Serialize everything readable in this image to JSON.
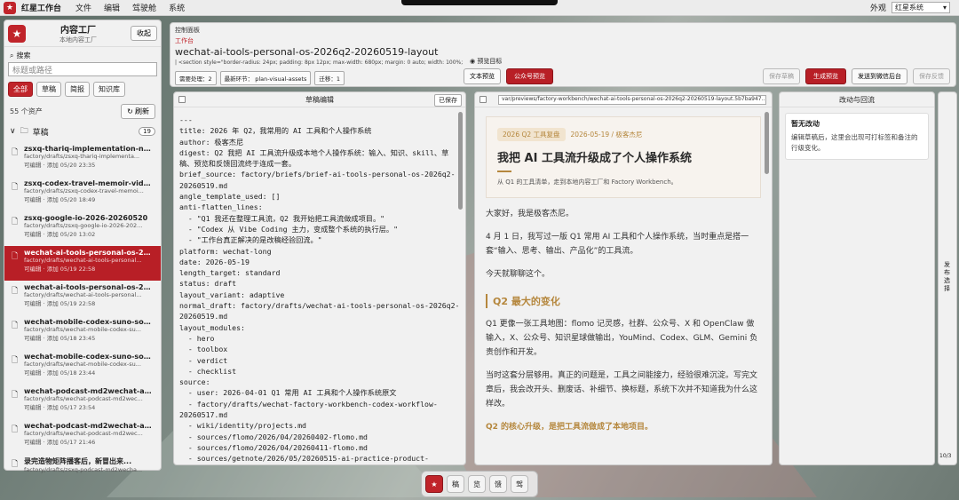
{
  "menubar": {
    "app_title": "红星工作台",
    "items": [
      "文件",
      "编辑",
      "驾驶舱",
      "系统"
    ],
    "appearance_label": "外观",
    "appearance_value": "红星系统"
  },
  "sidebar": {
    "title": "内容工厂",
    "subtitle": "本地内容工厂",
    "collapse_label": "收起",
    "search_label": "搜索",
    "search_placeholder": "标题或路径",
    "chips": [
      "全部",
      "草稿",
      "简报",
      "知识库"
    ],
    "asset_count": "55 个资产",
    "refresh_label": "刷新",
    "folder_name": "草稿",
    "folder_count": "19",
    "items": [
      {
        "name": "zsxq-thariq-implementation-note...",
        "path": "factory/drafts/zsxq-thariq-implementa...",
        "meta": "可编辑 · 添加 05/20 23:35"
      },
      {
        "name": "zsxq-codex-travel-memoir-video-...",
        "path": "factory/drafts/zsxq-codex-travel-memoi...",
        "meta": "可编辑 · 添加 05/20 18:49"
      },
      {
        "name": "zsxq-google-io-2026-20260520",
        "path": "factory/drafts/zsxq-google-io-2026-202...",
        "meta": "可编辑 · 添加 05/20 13:02"
      },
      {
        "name": "wechat-ai-tools-personal-os-202...",
        "path": "factory/drafts/wechat-ai-tools-personal...",
        "meta": "可编辑 · 添加 05/19 22:58"
      },
      {
        "name": "wechat-ai-tools-personal-os-202...",
        "path": "factory/drafts/wechat-ai-tools-personal...",
        "meta": "可编辑 · 添加 05/19 22:58"
      },
      {
        "name": "wechat-mobile-codex-suno-song...",
        "path": "factory/drafts/wechat-mobile-codex-su...",
        "meta": "可编辑 · 添加 05/18 23:45"
      },
      {
        "name": "wechat-mobile-codex-suno-song...",
        "path": "factory/drafts/wechat-mobile-codex-su...",
        "meta": "可编辑 · 添加 05/18 23:44"
      },
      {
        "name": "wechat-podcast-md2wechat-age...",
        "path": "factory/drafts/wechat-podcast-md2wec...",
        "meta": "可编辑 · 添加 05/17 23:54"
      },
      {
        "name": "wechat-podcast-md2wechat-age...",
        "path": "factory/drafts/wechat-podcast-md2wec...",
        "meta": "可编辑 · 添加 05/17 21:46"
      },
      {
        "name": "录完造物矩阵播客后，新冒出来...",
        "path": "factory/drafts/zsxq-podcast-md2wecha...",
        "meta": ""
      }
    ]
  },
  "control": {
    "panel_label": "控制面板",
    "workspace_label": "工作台",
    "title": "wechat-ai-tools-personal-os-2026q2-20260519-layout",
    "style_code": "| <section style=\"border-radius: 24px; padding: 8px 12px; max-width: 680px; margin: 0 auto; width: 100%; box-sizing: b",
    "target_label": "预览目标",
    "tags": [
      "需要处理：2",
      "最新环节： plan-visual-assets",
      "迁移：1"
    ],
    "text_preview_label": "文本预览",
    "wechat_preview_label": "公众号预览",
    "save_draft_label": "保存草稿",
    "generate_preview_label": "生成预览",
    "send_backend_label": "发送到微信后台",
    "save_feedback_label": "保存反馈"
  },
  "editor": {
    "header": "草稿编辑",
    "save_label": "已保存",
    "content": "---\ntitle: 2026 年 Q2，我常用的 AI 工具和个人操作系统\nauthor: 极客杰尼\ndigest: Q2 我把 AI 工具流升级成本地个人操作系统：输入、知识、skill、草稿、预览和反馈回流终于连成一套。\nbrief_source: factory/briefs/brief-ai-tools-personal-os-2026q2-20260519.md\nangle_template_used: []\nanti-flatten_lines:\n  - \"Q1 我还在整理工具流，Q2 我开始把工具流做成项目。\"\n  - \"Codex 从 Vibe Coding 主力，变成整个系统的执行层。\"\n  - \"工作台真正解决的是改稿经验回流。\"\nplatform: wechat-long\ndate: 2026-05-19\nlength_target: standard\nstatus: draft\nlayout_variant: adaptive\nnormal_draft: factory/drafts/wechat-ai-tools-personal-os-2026q2-20260519.md\nlayout_modules:\n  - hero\n  - toolbox\n  - verdict\n  - checklist\nsource:\n  - user: 2026-04-01 Q1 常用 AI 工具和个人操作系统原文\n  - factory/drafts/wechat-factory-workbench-codex-workflow-20260517.md\n  - wiki/identity/projects.md\n  - sources/flomo/2026/04/20260402-flomo.md\n  - sources/flomo/2026/04/20260411-flomo.md\n  - sources/getnote/2026/05/20260515-ai-practice-product-"
  },
  "preview": {
    "path": "var/previews/factory-workbench/wechat-ai-tools-personal-os-2026q2-20260519-layout.5b7ba947...",
    "hero_pill": "2026 Q2 工具复盘",
    "hero_meta": "2026-05-19 / 极客杰尼",
    "hero_title": "我把 AI 工具流升级成了个人操作系统",
    "hero_sub": "从 Q1 的工具清单，走到本地内容工厂和 Factory Workbench。",
    "p1": "大家好，我是极客杰尼。",
    "p2": "4 月 1 日，我写过一版 Q1 常用 AI 工具和个人操作系统，当时重点是搭一套“输入、思考、输出、产品化”的工具流。",
    "p3": "今天就聊聊这个。",
    "h2": "Q2 最大的变化",
    "p4": "Q1 更像一张工具地图：flomo 记灵感，社群、公众号、X 和 OpenClaw 做输入，X、公众号、知识星球做输出，YouMind、Codex、GLM、Gemini 负责创作和开发。",
    "p5": "当时这套分层够用。真正的问题是，工具之间能接力，经验很难沉淀。写完文章后，我会改开头、删废话、补细节、换标题，系统下次并不知道我为什么这样改。",
    "p6": "Q2 的核心升级，是把工具流做成了本地项目。"
  },
  "changes": {
    "header": "改动与回流",
    "box_title": "暂无改动",
    "box_body": "编辑草稿后，这里会出现可打标签和备注的行级变化。"
  },
  "side_tab": {
    "label": "发布选择",
    "page": "10/3"
  },
  "dock": {
    "items": [
      "稿",
      "览",
      "馈",
      "驾"
    ]
  },
  "colors": {
    "accent": "#c0242a",
    "gold": "#b5873d"
  }
}
